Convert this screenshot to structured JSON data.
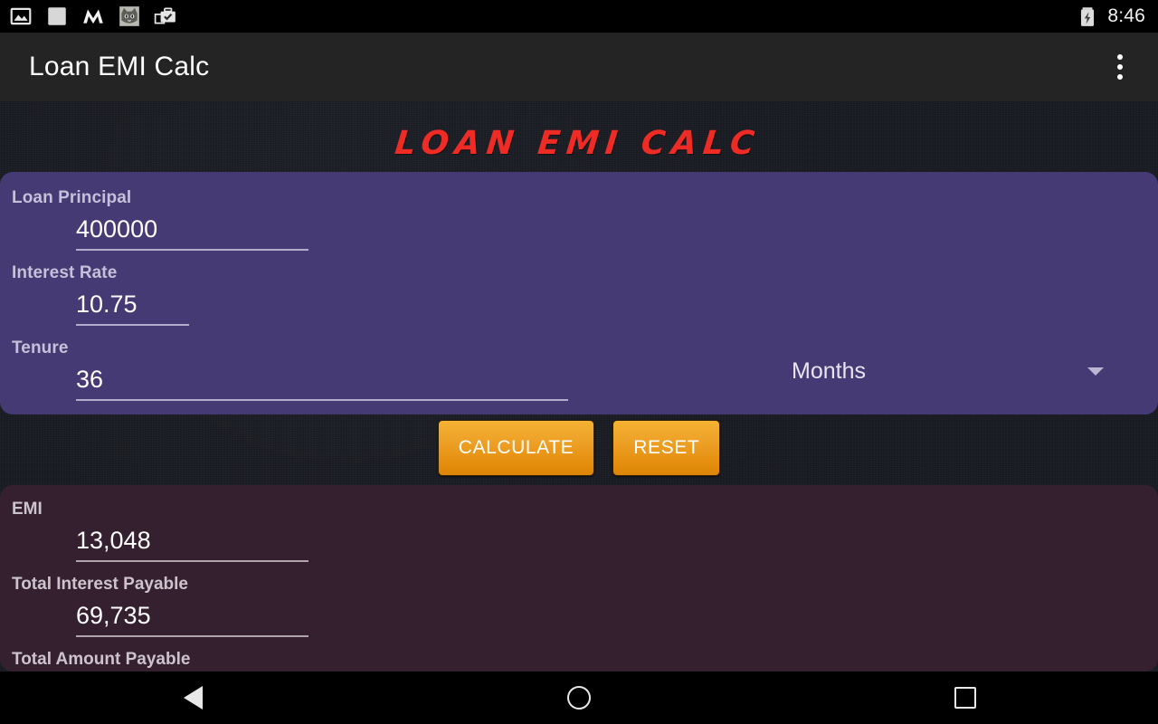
{
  "status_bar": {
    "time": "8:46",
    "icons": [
      "photo-icon",
      "blank-square-icon",
      "m-logo-icon",
      "cat-avatar-icon",
      "briefcase-check-icon"
    ],
    "battery_icon": "battery-charging-icon"
  },
  "app_bar": {
    "title": "Loan EMI Calc",
    "overflow_icon": "more-vertical-icon"
  },
  "heading": {
    "text": "LOAN EMI CALC",
    "color": "#ee2b24"
  },
  "input_card": {
    "background": "#453a74",
    "fields": [
      {
        "label": "Loan Principal",
        "value": "400000"
      },
      {
        "label": "Interest Rate",
        "value": "10.75"
      },
      {
        "label": "Tenure",
        "value": "36"
      }
    ],
    "tenure_unit": {
      "selected": "Months",
      "arrow_icon": "chevron-down-icon"
    }
  },
  "actions": {
    "calculate_label": "CALCULATE",
    "reset_label": "RESET",
    "button_color": "#eda127"
  },
  "result_card": {
    "background": "#35202f",
    "fields": [
      {
        "label": "EMI",
        "value": "13,048"
      },
      {
        "label": "Total Interest Payable",
        "value": "69,735"
      },
      {
        "label": "Total Amount Payable",
        "value": ""
      }
    ]
  },
  "nav_bar": {
    "back_label": "Back",
    "home_label": "Home",
    "recents_label": "Recents"
  }
}
